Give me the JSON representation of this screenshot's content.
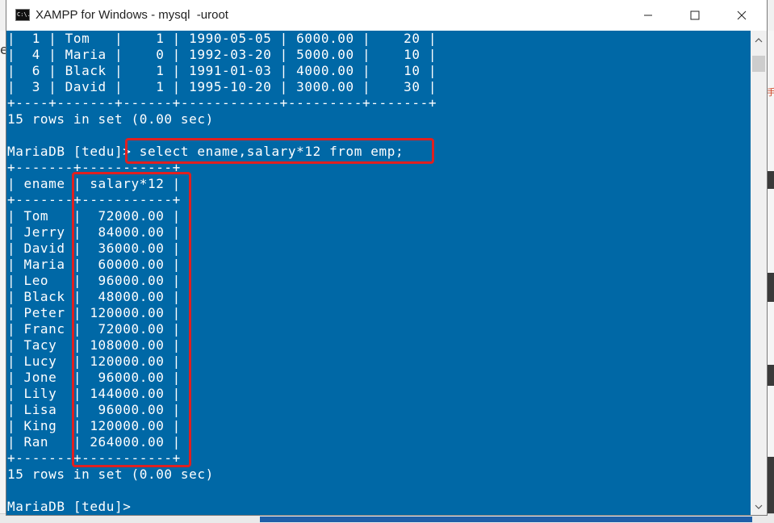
{
  "window": {
    "title": "XAMPP for Windows - mysql  -uroot",
    "icon_label": "C:\\.",
    "controls": [
      "minimize-icon",
      "maximize-icon",
      "close-icon"
    ]
  },
  "background": {
    "left_char": "e",
    "right_char": "手"
  },
  "console": {
    "lines": [
      "|  1 | Tom   |    1 | 1990-05-05 | 6000.00 |    20 |",
      "|  4 | Maria |    0 | 1992-03-20 | 5000.00 |    10 |",
      "|  6 | Black |    1 | 1991-01-03 | 4000.00 |    10 |",
      "|  3 | David |    1 | 1995-10-20 | 3000.00 |    30 |",
      "+----+-------+------+------------+---------+-------+",
      "15 rows in set (0.00 sec)",
      "",
      "MariaDB [tedu]> select ename,salary*12 from emp;",
      "+-------+-----------+",
      "| ename | salary*12 |",
      "+-------+-----------+",
      "| Tom   |  72000.00 |",
      "| Jerry |  84000.00 |",
      "| David |  36000.00 |",
      "| Maria |  60000.00 |",
      "| Leo   |  96000.00 |",
      "| Black |  48000.00 |",
      "| Peter | 120000.00 |",
      "| Franc |  72000.00 |",
      "| Tacy  | 108000.00 |",
      "| Lucy  | 120000.00 |",
      "| Jone  |  96000.00 |",
      "| Lily  | 144000.00 |",
      "| Lisa  |  96000.00 |",
      "| King  | 120000.00 |",
      "| Ran   | 264000.00 |",
      "+-------+-----------+",
      "15 rows in set (0.00 sec)",
      "",
      "MariaDB [tedu]>"
    ]
  },
  "colors": {
    "console_bg": "#0068a6",
    "console_text": "#ffffff",
    "highlight": "#e02020"
  }
}
